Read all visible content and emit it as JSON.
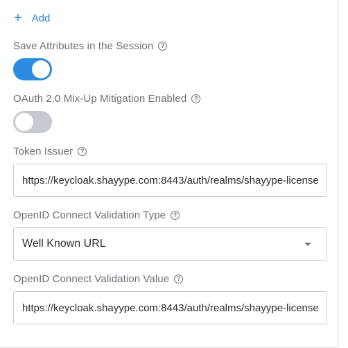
{
  "add": {
    "label": "Add",
    "icon": "plus-icon"
  },
  "save_attributes": {
    "label": "Save Attributes in the Session",
    "enabled": true
  },
  "oauth_mixup": {
    "label": "OAuth 2.0 Mix-Up Mitigation Enabled",
    "enabled": false
  },
  "token_issuer": {
    "label": "Token Issuer",
    "value": "https://keycloak.shayype.com:8443/auth/realms/shayype-license"
  },
  "validation_type": {
    "label": "OpenID Connect Validation Type",
    "selected": "Well Known URL"
  },
  "validation_value": {
    "label": "OpenID Connect Validation Value",
    "value": "https://keycloak.shayype.com:8443/auth/realms/shayype-license"
  },
  "colors": {
    "accent": "#2a8be0",
    "toggle_off": "#c7cad1",
    "label_text": "#6b6e75"
  },
  "help_icon": "?"
}
